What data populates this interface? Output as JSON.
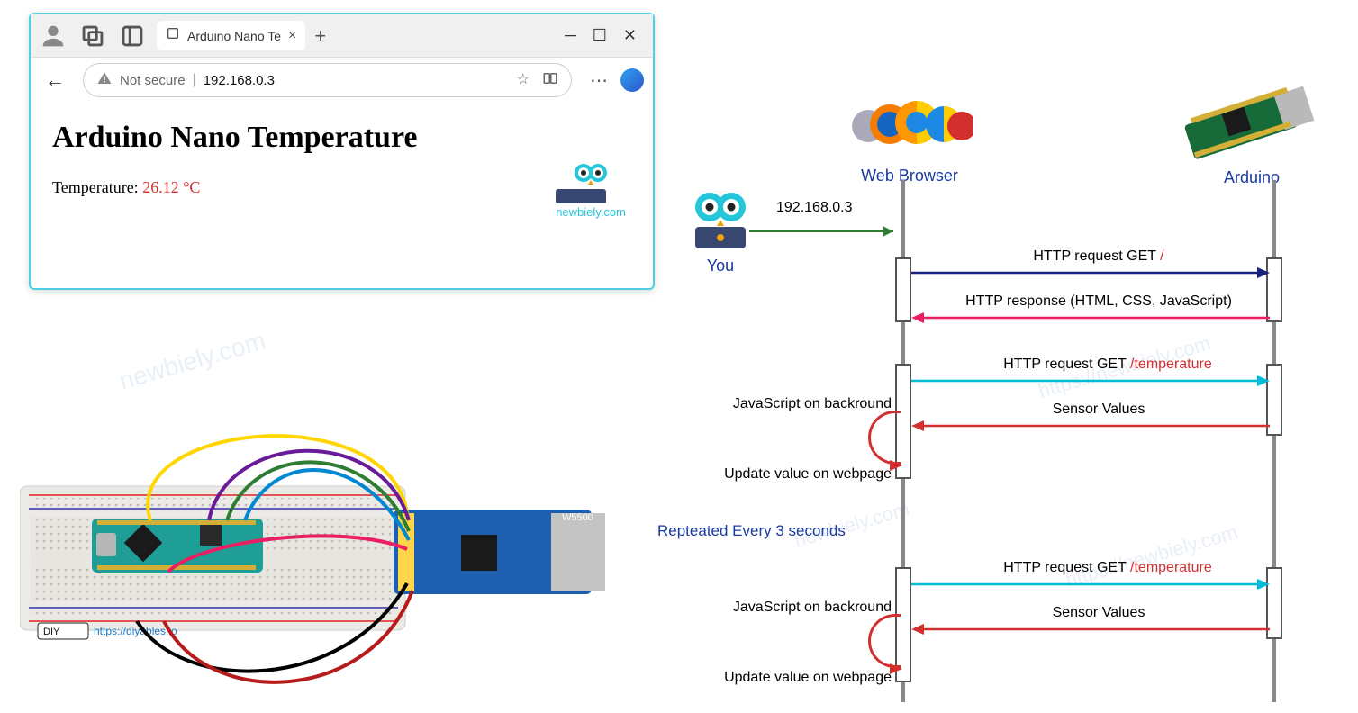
{
  "browser": {
    "tab_title": "Arduino Nano Te",
    "not_secure": "Not secure",
    "url": "192.168.0.3",
    "page_title": "Arduino Nano Temperature",
    "temp_label": "Temperature: ",
    "temp_value": "26.12 °C",
    "newbiely": "newbiely.com"
  },
  "watermarks": {
    "w1": "newbiely.com",
    "w2": "newbiely.com",
    "w3": "https://diyables.io",
    "w4": "https://newbiely.com",
    "w5": "newbiely.com",
    "w6": "https://newbiely.com"
  },
  "diagram": {
    "you_label": "You",
    "browser_label": "Web Browser",
    "arduino_label": "Arduino",
    "ip_text": "192.168.0.3",
    "msg1_pre": "HTTP request GET ",
    "msg1_path": "/",
    "msg2": "HTTP response (HTML, CSS, JavaScript)",
    "msg3_pre": "HTTP request GET ",
    "msg3_path": "/temperature",
    "msg4": "Sensor Values",
    "js_bg": "JavaScript on backround",
    "update": "Update value on webpage",
    "repeated": "Repteated Every 3 seconds"
  },
  "circuit": {
    "diyables_url": "https://diyables.io",
    "ethernet_chip": "W5500",
    "diy_badge": "DIY"
  }
}
